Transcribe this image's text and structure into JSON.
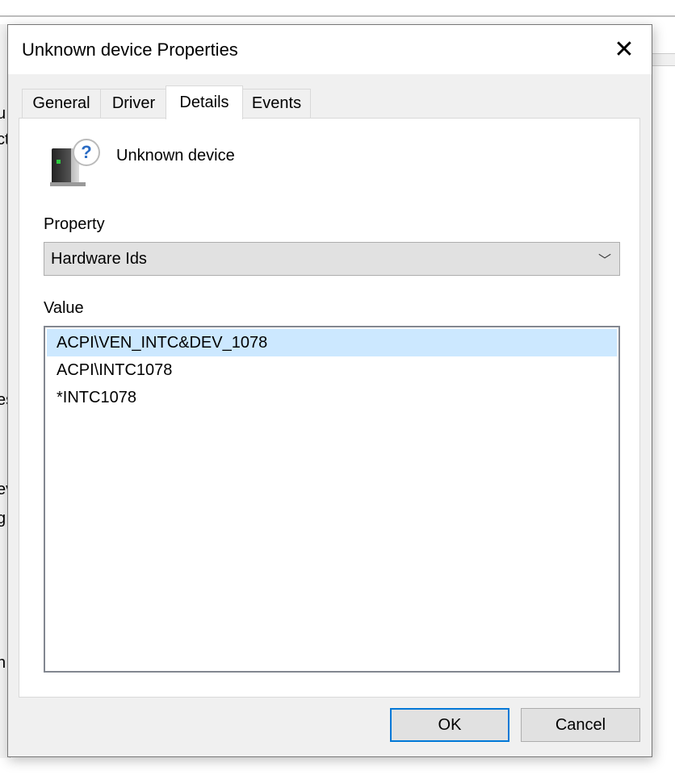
{
  "background": {
    "fragments": [
      "u",
      "ct",
      "es",
      "ev",
      "g",
      "n"
    ]
  },
  "dialog": {
    "title": "Unknown device Properties",
    "close_icon": "close-icon",
    "tabs": [
      {
        "label": "General",
        "active": false
      },
      {
        "label": "Driver",
        "active": false
      },
      {
        "label": "Details",
        "active": true
      },
      {
        "label": "Events",
        "active": false
      }
    ],
    "device": {
      "icon": "unknown-device-icon",
      "name": "Unknown device"
    },
    "property": {
      "label": "Property",
      "selected": "Hardware Ids"
    },
    "value": {
      "label": "Value",
      "items": [
        "ACPI\\VEN_INTC&DEV_1078",
        "ACPI\\INTC1078",
        "*INTC1078"
      ],
      "selected_index": 0
    },
    "buttons": {
      "ok": "OK",
      "cancel": "Cancel"
    },
    "colors": {
      "accent": "#0078d7",
      "selection": "#cce8ff"
    }
  }
}
